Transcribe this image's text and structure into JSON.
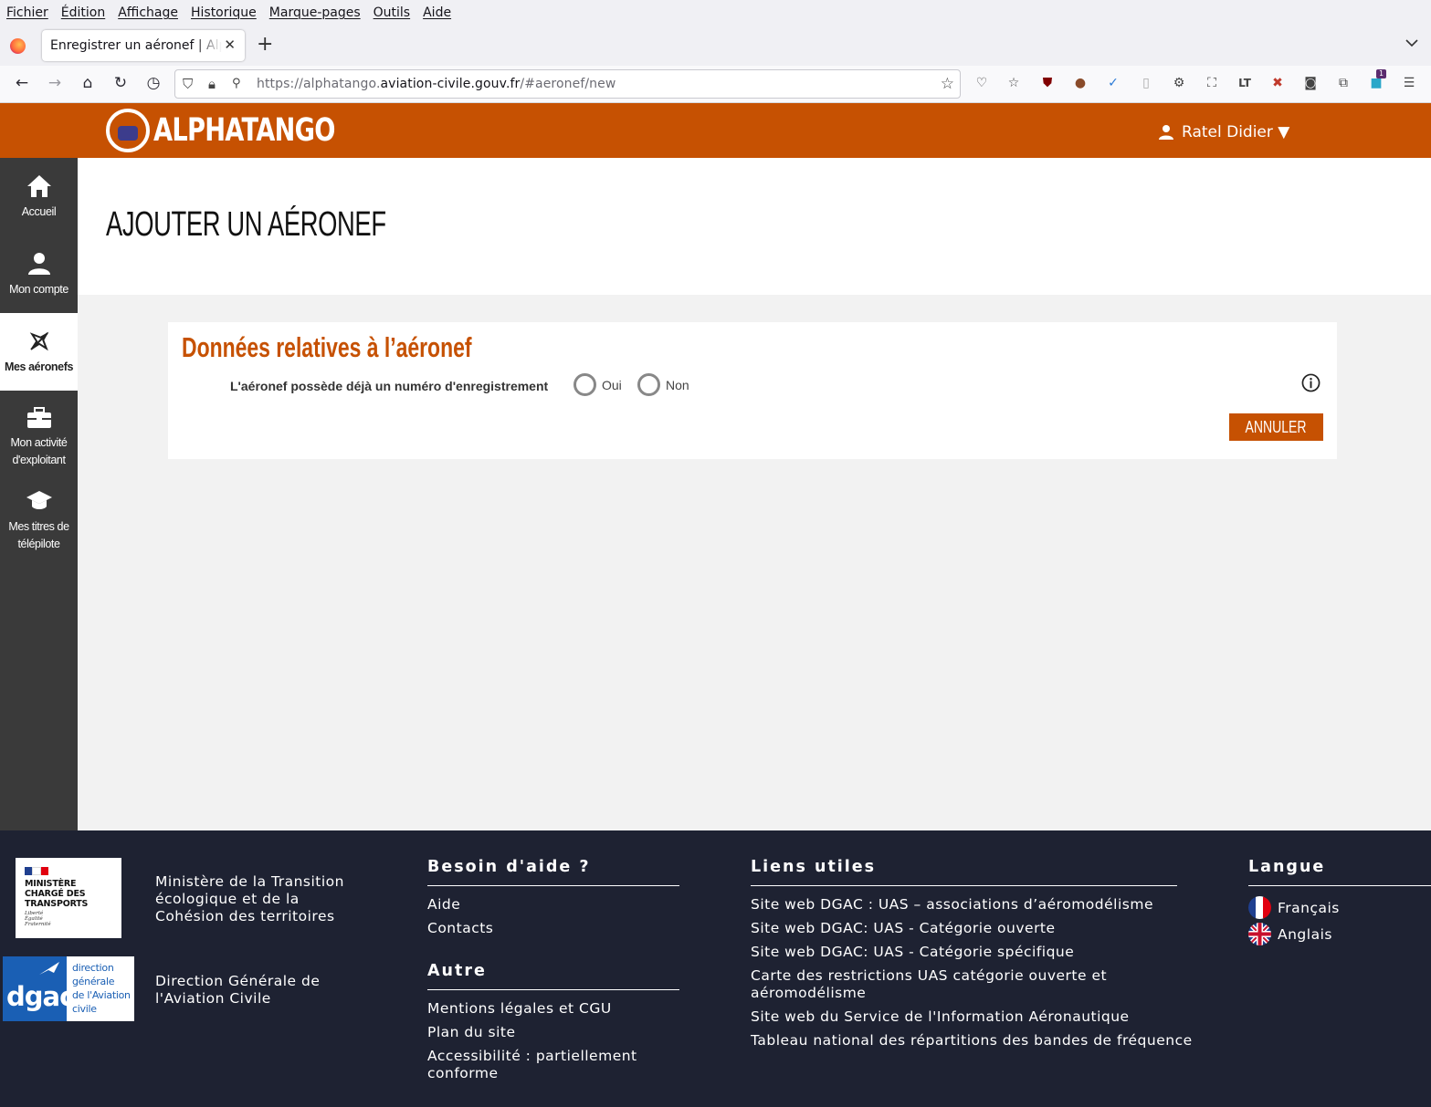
{
  "browser": {
    "menu": [
      "Fichier",
      "Édition",
      "Affichage",
      "Historique",
      "Marque-pages",
      "Outils",
      "Aide"
    ],
    "tab_title": "Enregistrer un aéronef | AlphaTango",
    "url_prefix": "https://alphatango.",
    "url_domain": "aviation-civile.gouv.fr",
    "url_path": "/#aeronef/new",
    "ext_badge": "1"
  },
  "header": {
    "logo_text": "ALPHATANGO",
    "user_name": "Ratel Didier ▼",
    "brand_color": "#c65102"
  },
  "sidebar": {
    "items": [
      {
        "label": "Accueil",
        "icon": "home-icon"
      },
      {
        "label": "Mon compte",
        "icon": "user-icon"
      },
      {
        "label": "Mes aéronefs",
        "icon": "aircraft-icon"
      },
      {
        "label1": "Mon activité",
        "label2": "d'exploitant",
        "icon": "briefcase-icon"
      },
      {
        "label1": "Mes titres de",
        "label2": "télépilote",
        "icon": "graduation-cap-icon"
      }
    ],
    "active_index": 2
  },
  "main": {
    "page_title": "AJOUTER UN AÉRONEF",
    "card_title": "Données relatives à l’aéronef",
    "question": "L'aéronef possède déjà un numéro d'enregistrement",
    "radio_yes": "Oui",
    "radio_no": "Non",
    "cancel_label": "ANNULER"
  },
  "footer": {
    "ministry_logo_text": "MINISTÈRE CHARGÉ DES TRANSPORTS",
    "ministry_motto_1": "Liberté",
    "ministry_motto_2": "Égalité",
    "ministry_motto_3": "Fraternité",
    "ministry_name_1": "Ministère de la Transition",
    "ministry_name_2": "écologique et de la",
    "ministry_name_3": "Cohésion des territoires",
    "dgac_logo_text": "dgac",
    "dgac_logo_l1": "direction",
    "dgac_logo_l2": "générale",
    "dgac_logo_l3": "de l'Aviation",
    "dgac_logo_l4": "civile",
    "dgac_name_1": "Direction Générale de",
    "dgac_name_2": "l'Aviation Civile",
    "help_heading": "Besoin d'aide ?",
    "help_links": [
      "Aide",
      "Contacts"
    ],
    "other_heading": "Autre",
    "other_links": [
      "Mentions légales et CGU",
      "Plan du site",
      "Accessibilité : partiellement",
      "conforme"
    ],
    "useful_heading": "Liens utiles",
    "useful_links": [
      "Site web DGAC : UAS – associations d’aéromodélisme",
      "Site web DGAC: UAS - Catégorie ouverte",
      "Site web DGAC: UAS - Catégorie spécifique",
      "Carte des restrictions UAS catégorie ouverte et",
      "aéromodélisme",
      "Site web du Service de l'Information Aéronautique",
      "Tableau national des répartitions des bandes de fréquence"
    ],
    "lang_heading": "Langue",
    "languages": [
      "Français",
      "Anglais"
    ]
  }
}
